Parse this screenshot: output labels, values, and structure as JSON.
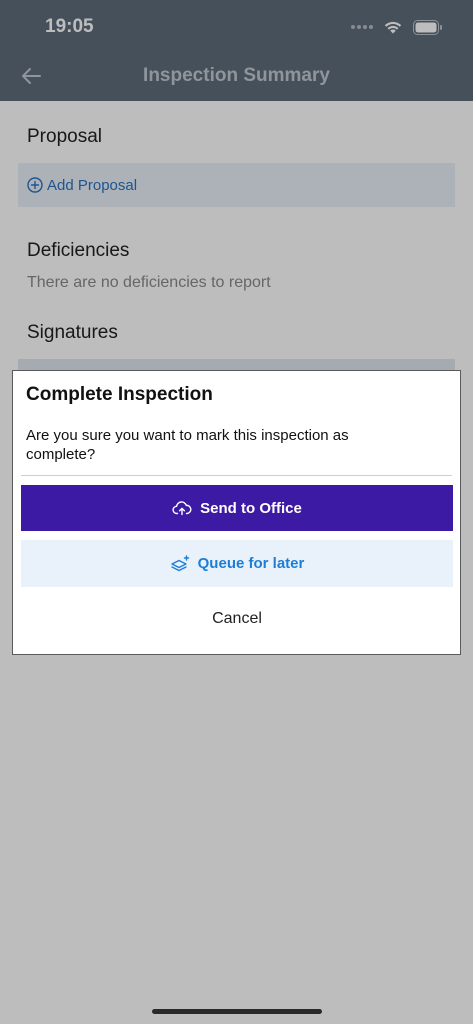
{
  "status_bar": {
    "time": "19:05",
    "icons": [
      "signal-dots-icon",
      "wifi-icon",
      "battery-icon"
    ]
  },
  "header": {
    "title": "Inspection Summary",
    "back_icon": "arrow-left-icon"
  },
  "sections": {
    "proposal": {
      "title": "Proposal",
      "add_label": "Add Proposal",
      "add_icon": "plus-circle-icon"
    },
    "deficiencies": {
      "title": "Deficiencies",
      "empty_text": "There are no deficiencies to report"
    },
    "signatures": {
      "title": "Signatures"
    }
  },
  "dialog": {
    "title": "Complete Inspection",
    "message": "Are you sure you want to mark this inspection as complete?",
    "primary_label": "Send to Office",
    "primary_icon": "cloud-upload-icon",
    "secondary_label": "Queue for later",
    "secondary_icon": "layers-plus-icon",
    "cancel_label": "Cancel"
  },
  "colors": {
    "header_bg": "#5d6c7b",
    "primary_button": "#3d1aa3",
    "secondary_button_bg": "#e9f1fb",
    "secondary_button_text": "#1d7ed8",
    "link_blue": "#2b73c2"
  }
}
